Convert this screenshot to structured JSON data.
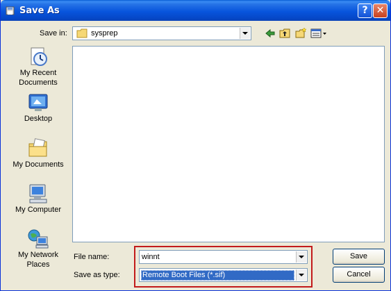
{
  "window": {
    "title": "Save As"
  },
  "titlebar_buttons": {
    "help": "?",
    "close": "✕"
  },
  "save_in": {
    "label": "Save in:",
    "folder": "sysprep",
    "icon": "folder-icon"
  },
  "toolbar": {
    "icons": [
      "back-arrow-icon",
      "up-folder-icon",
      "new-folder-icon",
      "view-menu-icon"
    ]
  },
  "places": [
    {
      "label_line1": "My Recent",
      "label_line2": "Documents",
      "icon": "recent-documents-icon"
    },
    {
      "label_line1": "Desktop",
      "label_line2": "",
      "icon": "desktop-icon"
    },
    {
      "label_line1": "My Documents",
      "label_line2": "",
      "icon": "my-documents-icon"
    },
    {
      "label_line1": "My Computer",
      "label_line2": "",
      "icon": "my-computer-icon"
    },
    {
      "label_line1": "My Network",
      "label_line2": "Places",
      "icon": "network-places-icon"
    }
  ],
  "file_name": {
    "label": "File name:",
    "value": "winnt"
  },
  "save_as_type": {
    "label": "Save as type:",
    "value": "Remote Boot Files (*.sif)"
  },
  "buttons": {
    "save": "Save",
    "cancel": "Cancel"
  },
  "colors": {
    "title_blue": "#0855dd",
    "highlight_box": "#c21a1a",
    "selection": "#316ac5"
  }
}
